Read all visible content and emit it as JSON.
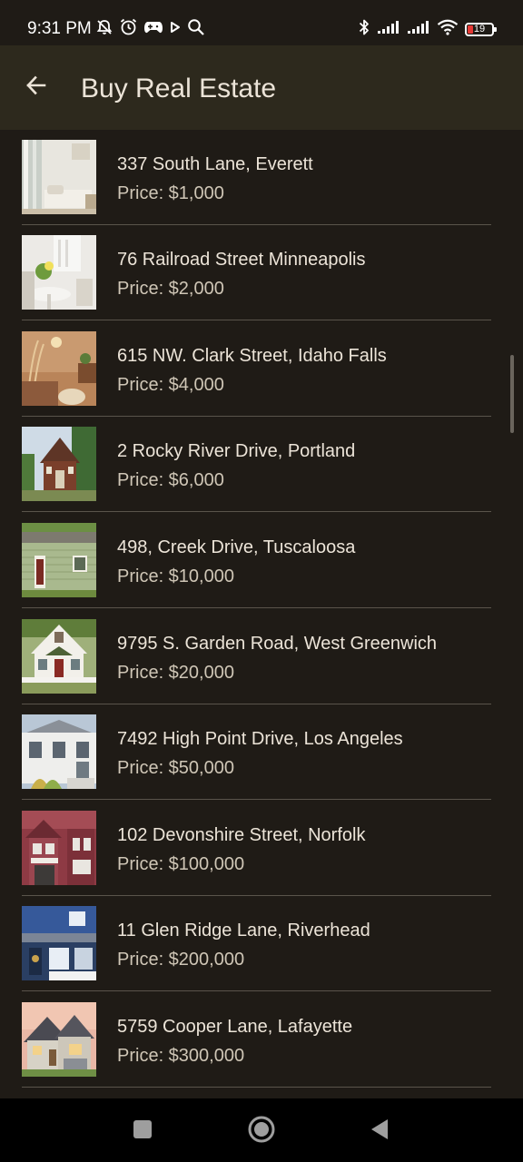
{
  "status_bar": {
    "time": "9:31 PM",
    "left_icons": [
      "bell-off-icon",
      "alarm-icon",
      "game-controller-icon",
      "play-icon",
      "search-icon"
    ],
    "right_icons": [
      "bluetooth-icon",
      "signal-icon",
      "signal-icon",
      "wifi-icon"
    ],
    "battery_level": "19",
    "battery_color": "#e53935"
  },
  "app_bar": {
    "back_icon": "arrow-left-icon",
    "title": "Buy Real Estate"
  },
  "listings": [
    {
      "address": "337 South Lane, Everett",
      "price": "Price: $1,000",
      "photo": "bedroom-interior"
    },
    {
      "address": "76 Railroad Street Minneapolis",
      "price": "Price: $2,000",
      "photo": "white-dining-room"
    },
    {
      "address": "615 NW. Clark Street, Idaho Falls",
      "price": "Price: $4,000",
      "photo": "boho-living-room"
    },
    {
      "address": "2 Rocky River Drive, Portland",
      "price": "Price: $6,000",
      "photo": "tiny-house"
    },
    {
      "address": "498, Creek Drive, Tuscaloosa",
      "price": "Price: $10,000",
      "photo": "green-cottage"
    },
    {
      "address": "9795 S. Garden Road, West Greenwich",
      "price": "Price: $20,000",
      "photo": "white-cottage"
    },
    {
      "address": "7492 High Point Drive, Los Angeles",
      "price": "Price: $50,000",
      "photo": "white-house"
    },
    {
      "address": "102 Devonshire Street, Norfolk",
      "price": "Price: $100,000",
      "photo": "victorian-house"
    },
    {
      "address": "11 Glen Ridge Lane, Riverhead",
      "price": "Price: $200,000",
      "photo": "blue-house"
    },
    {
      "address": "5759 Cooper Lane, Lafayette",
      "price": "Price: $300,000",
      "photo": "suburban-house"
    }
  ],
  "nav_bar": {
    "buttons": [
      "recents-square-icon",
      "home-circle-icon",
      "back-triangle-icon"
    ]
  },
  "colors": {
    "background": "#1f1b16",
    "app_bar": "#2d291d",
    "text_primary": "#ece4d8",
    "text_secondary": "#cfc6b6",
    "divider": "#5a544b"
  }
}
